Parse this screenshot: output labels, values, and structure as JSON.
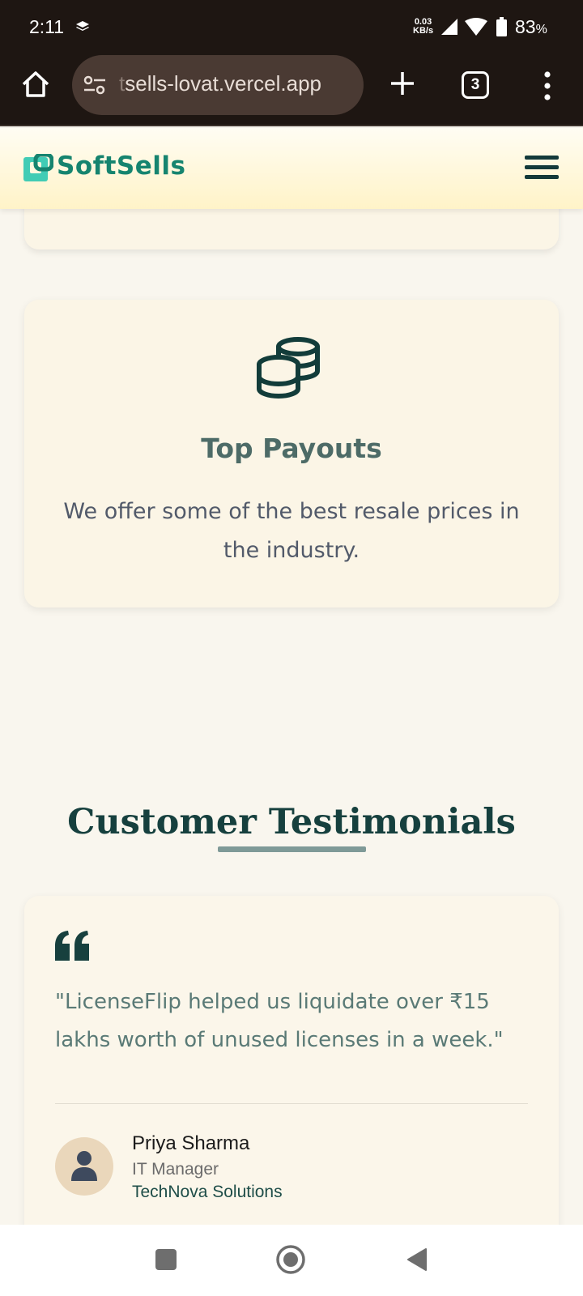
{
  "status_bar": {
    "time": "2:11",
    "net_speed_value": "0.03",
    "net_speed_unit": "KB/s",
    "battery_value": "83",
    "battery_unit": "%"
  },
  "browser": {
    "url_prefix": "t",
    "url_rest": "sells-lovat.vercel.app",
    "tab_count": "3"
  },
  "site": {
    "brand": "SoftSells",
    "brand_color": "#16846f"
  },
  "feature": {
    "icon": "coins-icon",
    "title": "Top Payouts",
    "description": "We offer some of the best resale prices in the industry."
  },
  "testimonials": {
    "section_title": "Customer Testimonials",
    "quote": "\"LicenseFlip helped us liquidate over ₹15 lakhs worth of unused licenses in a week.\"",
    "name": "Priya Sharma",
    "role": "IT Manager",
    "company": "TechNova Solutions"
  },
  "colors": {
    "dark_teal": "#133a3a",
    "page_bg": "#f9f6ee",
    "card_bg": "#fbf5e6"
  }
}
